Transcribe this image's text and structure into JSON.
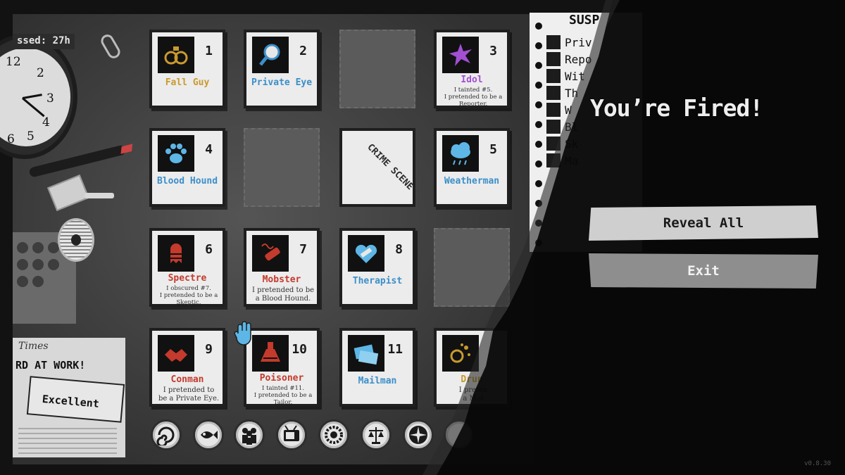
{
  "game": {
    "elapsed": "ssed: 27h",
    "title": "You’re Fired!",
    "buttons": {
      "reveal_all": "Reveal All",
      "exit": "Exit"
    },
    "version": "v0.8.30"
  },
  "clock": {
    "numbers": [
      "12",
      "2",
      "3",
      "4",
      "5",
      "6"
    ]
  },
  "newspaper": {
    "masthead": "Times",
    "headline": "RD AT WORK!",
    "rating": "Excellent"
  },
  "crime_scene": {
    "label": "CRIME SCENE"
  },
  "cards": [
    {
      "num": "1",
      "role": "Fall Guy",
      "role_color": "#c99a2e",
      "icon": "handcuffs-icon",
      "notes": []
    },
    {
      "num": "2",
      "role": "Private Eye",
      "role_color": "#3b8fc9",
      "icon": "magnifier-icon",
      "notes": []
    },
    {
      "num": "3",
      "role": "Idol",
      "role_color": "#a24fd1",
      "icon": "star-icon",
      "notes": [
        "I tainted #5.",
        "I pretended to be a",
        "Reporter."
      ]
    },
    {
      "num": "4",
      "role": "Blood Hound",
      "role_color": "#3b8fc9",
      "icon": "paw-icon",
      "notes": []
    },
    {
      "num": "5",
      "role": "Weatherman",
      "role_color": "#3b8fc9",
      "icon": "cloud-icon",
      "notes": []
    },
    {
      "num": "6",
      "role": "Spectre",
      "role_color": "#c43a2c",
      "icon": "ghost-icon",
      "notes": [
        "I obscured #7.",
        "I pretended to be a",
        "Skeptic."
      ]
    },
    {
      "num": "7",
      "role": "Mobster",
      "role_color": "#c43a2c",
      "icon": "cigar-icon",
      "notes": [
        "I pretended to be",
        "a Blood Hound."
      ]
    },
    {
      "num": "8",
      "role": "Therapist",
      "role_color": "#3b8fc9",
      "icon": "heart-bandage-icon",
      "notes": []
    },
    {
      "num": "9",
      "role": "Conman",
      "role_color": "#c43a2c",
      "icon": "handshake-icon",
      "notes": [
        "I pretended to",
        "be a Private Eye."
      ]
    },
    {
      "num": "10",
      "role": "Poisoner",
      "role_color": "#c43a2c",
      "icon": "flask-icon",
      "notes": [
        "I tainted #11.",
        "I pretended to be a",
        "Tailor."
      ]
    },
    {
      "num": "11",
      "role": "Mailman",
      "role_color": "#3b8fc9",
      "icon": "envelope-icon",
      "notes": []
    },
    {
      "num": "",
      "role": "Drun",
      "role_color": "#c99a2e",
      "icon": "bubbles-icon",
      "notes": [
        "I preten",
        "a Mat"
      ]
    }
  ],
  "notepad": {
    "title": "SUSP",
    "items": [
      {
        "text": "Priv",
        "icon": "magnifier-icon"
      },
      {
        "text": "Repo",
        "icon": "hat-icon"
      },
      {
        "text": "Wit",
        "icon": "eye-icon"
      },
      {
        "text": "Th",
        "icon": "heart-icon"
      },
      {
        "text": "W",
        "icon": "cloud-icon"
      },
      {
        "text": "Bl",
        "icon": "paw-icon"
      },
      {
        "text": "Sk",
        "icon": "question-icon"
      },
      {
        "text": "Ma",
        "icon": "envelope-icon"
      }
    ]
  },
  "tokens": [
    "vortex-icon",
    "fish-icon",
    "crowd-icon",
    "tv-icon",
    "gear-ring-icon",
    "scales-icon",
    "burst-icon",
    "partial-icon"
  ],
  "colors": {
    "blue": "#3b8fc9",
    "red": "#c43a2c",
    "gold": "#c99a2e",
    "purple": "#a24fd1"
  }
}
